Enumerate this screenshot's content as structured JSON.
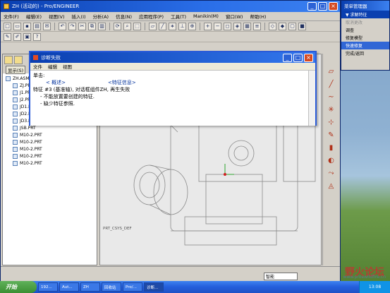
{
  "main_window": {
    "title": "ZH (活动的) - Pro/ENGINEER",
    "menu": [
      "文件(F)",
      "编辑(E)",
      "视图(V)",
      "插入(I)",
      "分析(A)",
      "信息(N)",
      "应用程序(P)",
      "工具(T)",
      "Manikin(M)",
      "窗口(W)",
      "帮助(H)"
    ]
  },
  "tree": {
    "show_label": "显示(S)",
    "items": [
      {
        "label": "ZH.ASM",
        "child": false
      },
      {
        "label": "ZJ.PRT",
        "child": true
      },
      {
        "label": "J1.PRT",
        "child": true
      },
      {
        "label": "J2.PRT",
        "child": true
      },
      {
        "label": "JD1.PRT",
        "child": true
      },
      {
        "label": "JD2.PRT",
        "child": true
      },
      {
        "label": "JD3.PRT",
        "child": true
      },
      {
        "label": "JSB.PRT",
        "child": true
      },
      {
        "label": "M10-2.PRT",
        "child": true
      },
      {
        "label": "M10-2.PRT",
        "child": true
      },
      {
        "label": "M10-2.PRT",
        "child": true
      },
      {
        "label": "M10-2.PRT",
        "child": true
      },
      {
        "label": "M10-2.PRT",
        "child": true
      }
    ]
  },
  "dialog": {
    "title": "诊断失败",
    "menu": [
      "文件",
      "编辑",
      "视图"
    ],
    "click_label": "单击:",
    "link_overview": "< 概述>",
    "link_feature_info": "<特征信息>",
    "line_feature": "特征 #3 (基准轴), 对话框组件ZH, 再生失败",
    "bullet_1": "- 不能放置要创建的特征.",
    "bullet_2": "- 缺少特征参照."
  },
  "menu_manager": {
    "title": "菜单管理器",
    "items": [
      {
        "label": "▼ 求解特征",
        "state": "header"
      },
      {
        "label": "取消更改",
        "state": "disabled"
      },
      {
        "label": "调查",
        "state": "normal"
      },
      {
        "label": "修复模型",
        "state": "normal"
      },
      {
        "label": "快速修复",
        "state": "selected"
      },
      {
        "label": "完成/返回",
        "state": "normal"
      }
    ]
  },
  "graphics": {
    "status_code": "PRT_CSYS_DEF",
    "smart_filter": "智能"
  },
  "taskbar": {
    "start": "开始",
    "tasks": [
      "192...",
      "Aut...",
      "ZH",
      "回收站",
      "Pro/..."
    ],
    "active_task": "诊断...",
    "clock": "13:08"
  },
  "watermark": {
    "text": "野火论坛",
    "url": "www.proewildfire.cn"
  }
}
